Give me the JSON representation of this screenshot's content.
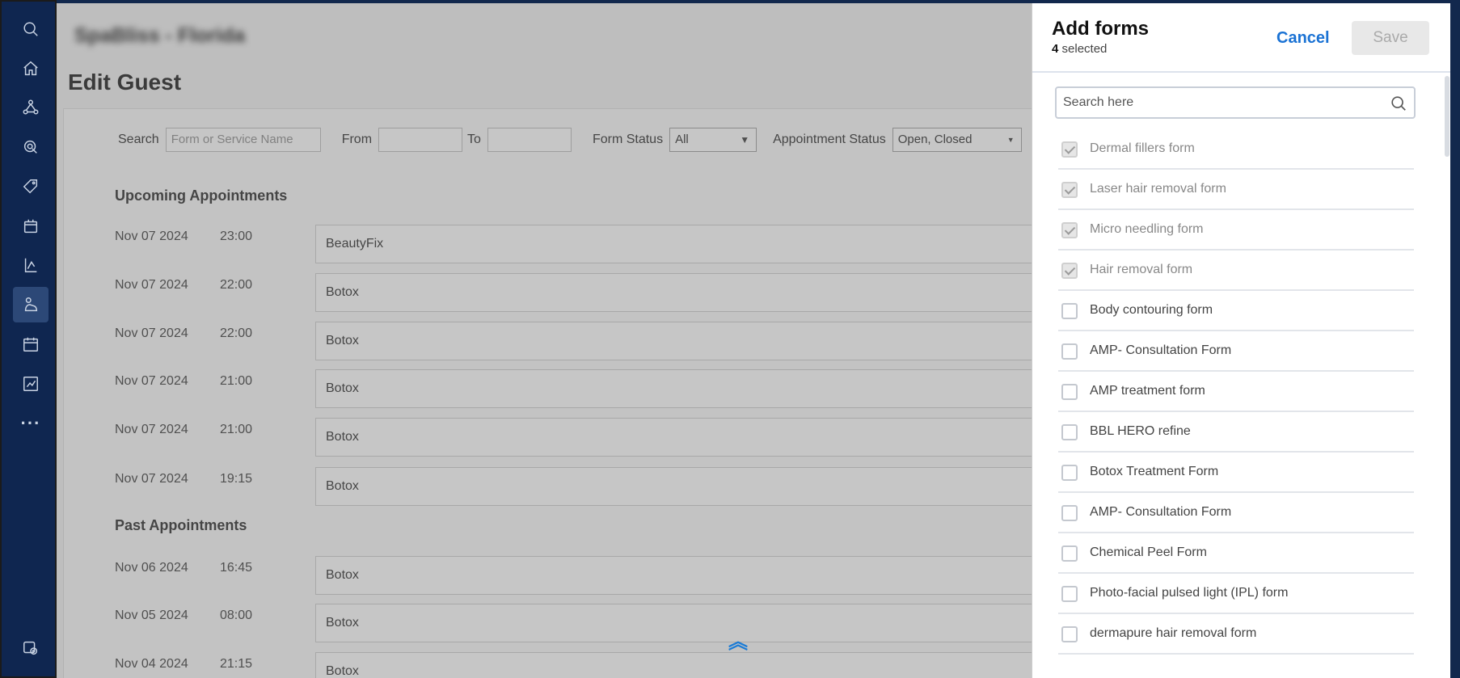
{
  "location": "SpaBliss - Florida",
  "page_title": "Edit Guest",
  "filters": {
    "search_label": "Search",
    "search_placeholder": "Form or Service Name",
    "from_label": "From",
    "to_label": "To",
    "form_status_label": "Form Status",
    "form_status_value": "All",
    "appt_status_label": "Appointment Status",
    "appt_status_value": "Open, Closed"
  },
  "upcoming": {
    "heading": "Upcoming Appointments",
    "rows": [
      {
        "date": "Nov 07 2024",
        "time": "23:00",
        "service": "BeautyFix"
      },
      {
        "date": "Nov 07 2024",
        "time": "22:00",
        "service": "Botox"
      },
      {
        "date": "Nov 07 2024",
        "time": "22:00",
        "service": "Botox"
      },
      {
        "date": "Nov 07 2024",
        "time": "21:00",
        "service": "Botox"
      },
      {
        "date": "Nov 07 2024",
        "time": "21:00",
        "service": "Botox"
      },
      {
        "date": "Nov 07 2024",
        "time": "19:15",
        "service": "Botox"
      }
    ]
  },
  "past": {
    "heading": "Past Appointments",
    "rows": [
      {
        "date": "Nov 06 2024",
        "time": "16:45",
        "service": "Botox"
      },
      {
        "date": "Nov 05 2024",
        "time": "08:00",
        "service": "Botox"
      },
      {
        "date": "Nov 04 2024",
        "time": "21:15",
        "service": "Botox"
      }
    ]
  },
  "panel": {
    "title": "Add forms",
    "selected_count": "4",
    "selected_suffix": "selected",
    "cancel_label": "Cancel",
    "save_label": "Save",
    "search_placeholder": "Search here",
    "forms": [
      {
        "label": "Dermal fillers form",
        "checked": true
      },
      {
        "label": "Laser hair removal form",
        "checked": true
      },
      {
        "label": "Micro needling form",
        "checked": true
      },
      {
        "label": "Hair removal form",
        "checked": true
      },
      {
        "label": "Body contouring form",
        "checked": false
      },
      {
        "label": "AMP- Consultation Form",
        "checked": false
      },
      {
        "label": "AMP treatment form",
        "checked": false
      },
      {
        "label": "BBL HERO refine",
        "checked": false
      },
      {
        "label": "Botox Treatment Form",
        "checked": false
      },
      {
        "label": "AMP- Consultation Form",
        "checked": false
      },
      {
        "label": "Chemical Peel Form",
        "checked": false
      },
      {
        "label": "Photo-facial pulsed light (IPL) form",
        "checked": false
      },
      {
        "label": "dermapure hair removal form",
        "checked": false
      }
    ]
  },
  "sidebar_icons": [
    "search-icon",
    "home-icon",
    "network-icon",
    "marketing-icon",
    "tag-icon",
    "package-icon",
    "reports-icon",
    "guest-icon",
    "calendar-icon",
    "analytics-icon",
    "more-icon",
    "settings-icon"
  ],
  "colors": {
    "sidebar": "#0f2650",
    "accent": "#1a72d4"
  }
}
